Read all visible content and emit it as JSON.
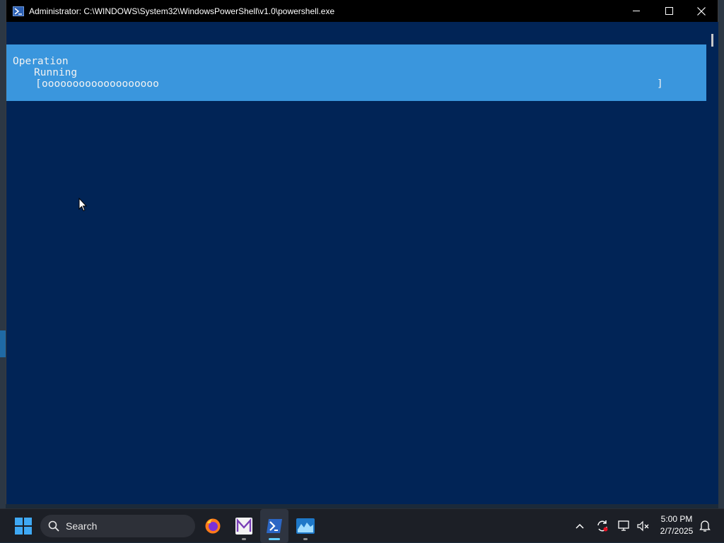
{
  "window": {
    "title": "Administrator: C:\\WINDOWS\\System32\\WindowsPowerShell\\v1.0\\powershell.exe",
    "controls": {
      "minimize": "minimize-icon",
      "maximize": "maximize-icon",
      "close": "close-icon"
    }
  },
  "console": {
    "background": "#012456",
    "progress": {
      "background": "#3a96dd",
      "activity": "Operation",
      "status": "Running",
      "bar_open": "[",
      "bar_fill": "ooooooooooooooooooo",
      "bar_close": "]",
      "fraction": 0.21
    }
  },
  "taskbar": {
    "search_label": "Search",
    "apps": [
      {
        "name": "firefox",
        "icon": "firefox-icon"
      },
      {
        "name": "m-app",
        "icon": "m-app-icon"
      },
      {
        "name": "powershell",
        "icon": "powershell-icon",
        "active": true
      },
      {
        "name": "blue-app",
        "icon": "blue-app-icon"
      }
    ],
    "tray": {
      "icons": [
        "chevron-up-icon",
        "sync-icon",
        "network-icon",
        "volume-muted-icon",
        "notification-icon"
      ]
    },
    "clock": {
      "time": "5:00 PM",
      "date": "2/7/2025"
    }
  }
}
